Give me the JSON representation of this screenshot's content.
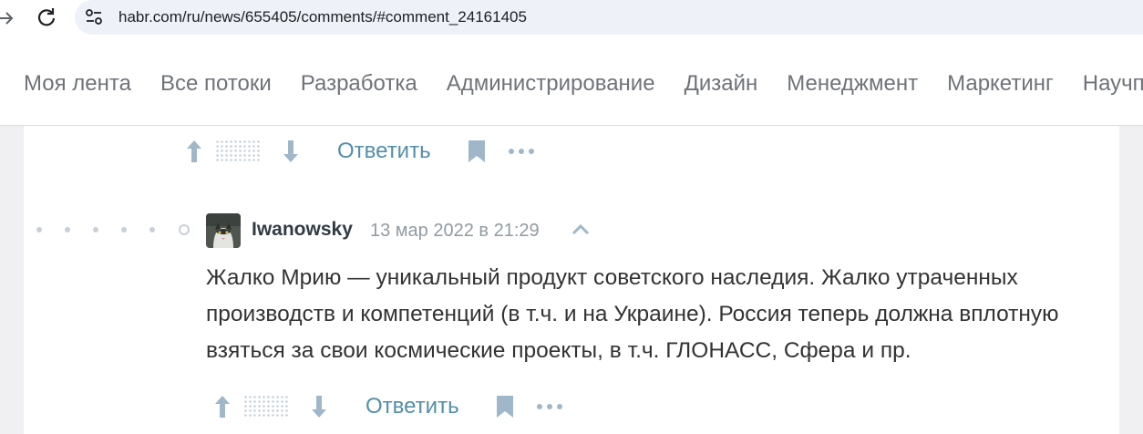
{
  "browser": {
    "url": "habr.com/ru/news/655405/comments/#comment_24161405"
  },
  "nav": {
    "items": [
      "Моя лента",
      "Все потоки",
      "Разработка",
      "Администрирование",
      "Дизайн",
      "Менеджмент",
      "Маркетинг",
      "Научпоп"
    ]
  },
  "previous_comment": {
    "reply_label": "Ответить"
  },
  "comment": {
    "username": "Iwanowsky",
    "date": "13 мар 2022 в 21:29",
    "text": "Жалко Мрию — уникальный продукт советского наследия. Жалко утраченных производств и компетенций (в т.ч. и на Украине). Россия теперь должна вплотную взяться за свои космические проекты, в т.ч. ГЛОНАСС, Сфера и пр.",
    "reply_label": "Ответить"
  },
  "colors": {
    "link": "#548eaa",
    "icon": "#9fb7c9",
    "nav_text": "#6f7378"
  },
  "icons": [
    "arrow-up-icon",
    "arrow-down-icon",
    "bookmark-icon",
    "more-icon",
    "collapse-chevron-icon",
    "reload-icon",
    "site-info-icon"
  ]
}
